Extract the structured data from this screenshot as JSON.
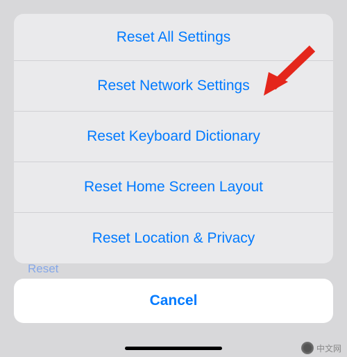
{
  "background": {
    "hidden_label": "Reset"
  },
  "sheet": {
    "items": [
      {
        "label": "Reset All Settings"
      },
      {
        "label": "Reset Network Settings"
      },
      {
        "label": "Reset Keyboard Dictionary"
      },
      {
        "label": "Reset Home Screen Layout"
      },
      {
        "label": "Reset Location & Privacy"
      }
    ]
  },
  "cancel": {
    "label": "Cancel"
  },
  "watermark": {
    "text": "中文网"
  },
  "annotation": {
    "color": "#e4261b",
    "target_item_index": 1
  }
}
